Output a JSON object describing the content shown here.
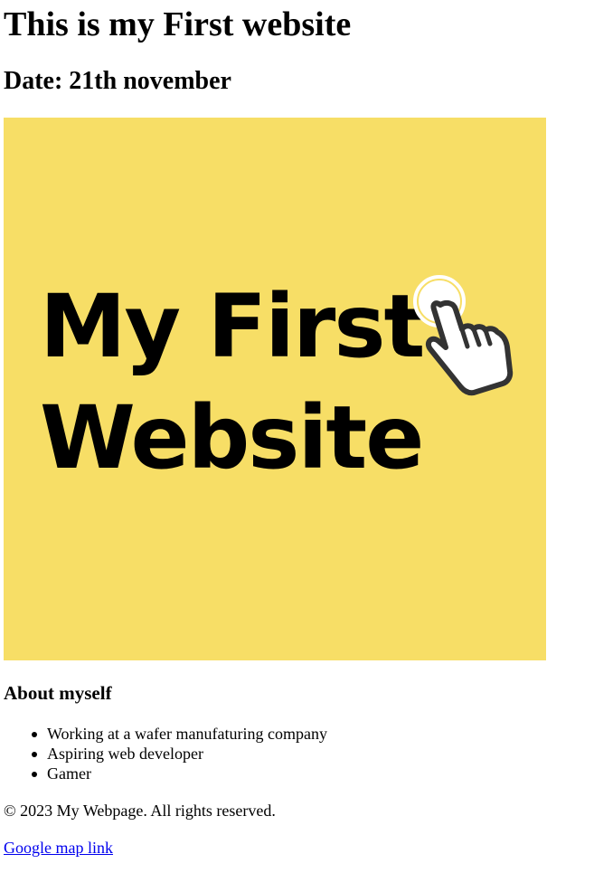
{
  "page": {
    "title": "This is my First website",
    "date": "Date: 21th november"
  },
  "hero_image": {
    "line1": "My First",
    "line2": "Website",
    "icon": "pointer-hand-icon",
    "colors": {
      "background": "#f7de66",
      "text": "#000000",
      "icon_stroke": "#333333",
      "icon_fill": "#ffffff"
    }
  },
  "about": {
    "heading": "About myself",
    "items": [
      "Working at a wafer manufaturing company",
      "Aspiring web developer",
      "Gamer"
    ]
  },
  "footer": {
    "copyright": "© 2023 My Webpage. All rights reserved.",
    "link_label": "Google map link"
  },
  "colors": {
    "link": "#0000ee"
  }
}
